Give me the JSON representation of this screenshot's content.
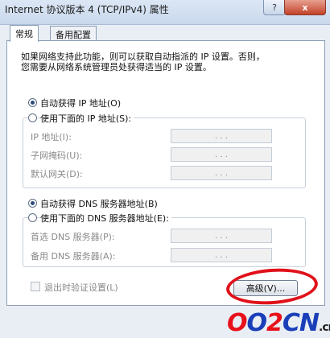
{
  "window": {
    "title": "Internet 协议版本 4 (TCP/IPv4) 属性",
    "help_label": "?",
    "close_label": "x"
  },
  "tabs": [
    {
      "label": "常规",
      "active": true
    },
    {
      "label": "备用配置",
      "active": false
    }
  ],
  "description": {
    "line1": "如果网络支持此功能，则可以获取自动指派的 IP 设置。否则，",
    "line2": "您需要从网络系统管理员处获得适当的 IP 设置。"
  },
  "ip": {
    "auto_label": "自动获得 IP 地址(O)",
    "manual_label": "使用下面的 IP 地址(S):",
    "selected": "auto",
    "fields": [
      {
        "label": "IP 地址(I):",
        "value": ". . ."
      },
      {
        "label": "子网掩码(U):",
        "value": ". . ."
      },
      {
        "label": "默认网关(D):",
        "value": ". . ."
      }
    ]
  },
  "dns": {
    "auto_label": "自动获得 DNS 服务器地址(B)",
    "manual_label": "使用下面的 DNS 服务器地址(E):",
    "selected": "auto",
    "fields": [
      {
        "label": "首选 DNS 服务器(P):",
        "value": ". . ."
      },
      {
        "label": "备用 DNS 服务器(A):",
        "value": ". . ."
      }
    ]
  },
  "validate": {
    "label": "退出时验证设置(L)",
    "checked": false
  },
  "advanced_button": {
    "label": "高级(V)..."
  },
  "watermark": {
    "part1": "O",
    "part2": "O",
    "part3": "2",
    "part4": "CN",
    "suffix": ".cn"
  },
  "colors": {
    "highlight_circle": "#e0101a",
    "watermark_red": "#e8111a",
    "watermark_blue": "#1a3fb8"
  }
}
